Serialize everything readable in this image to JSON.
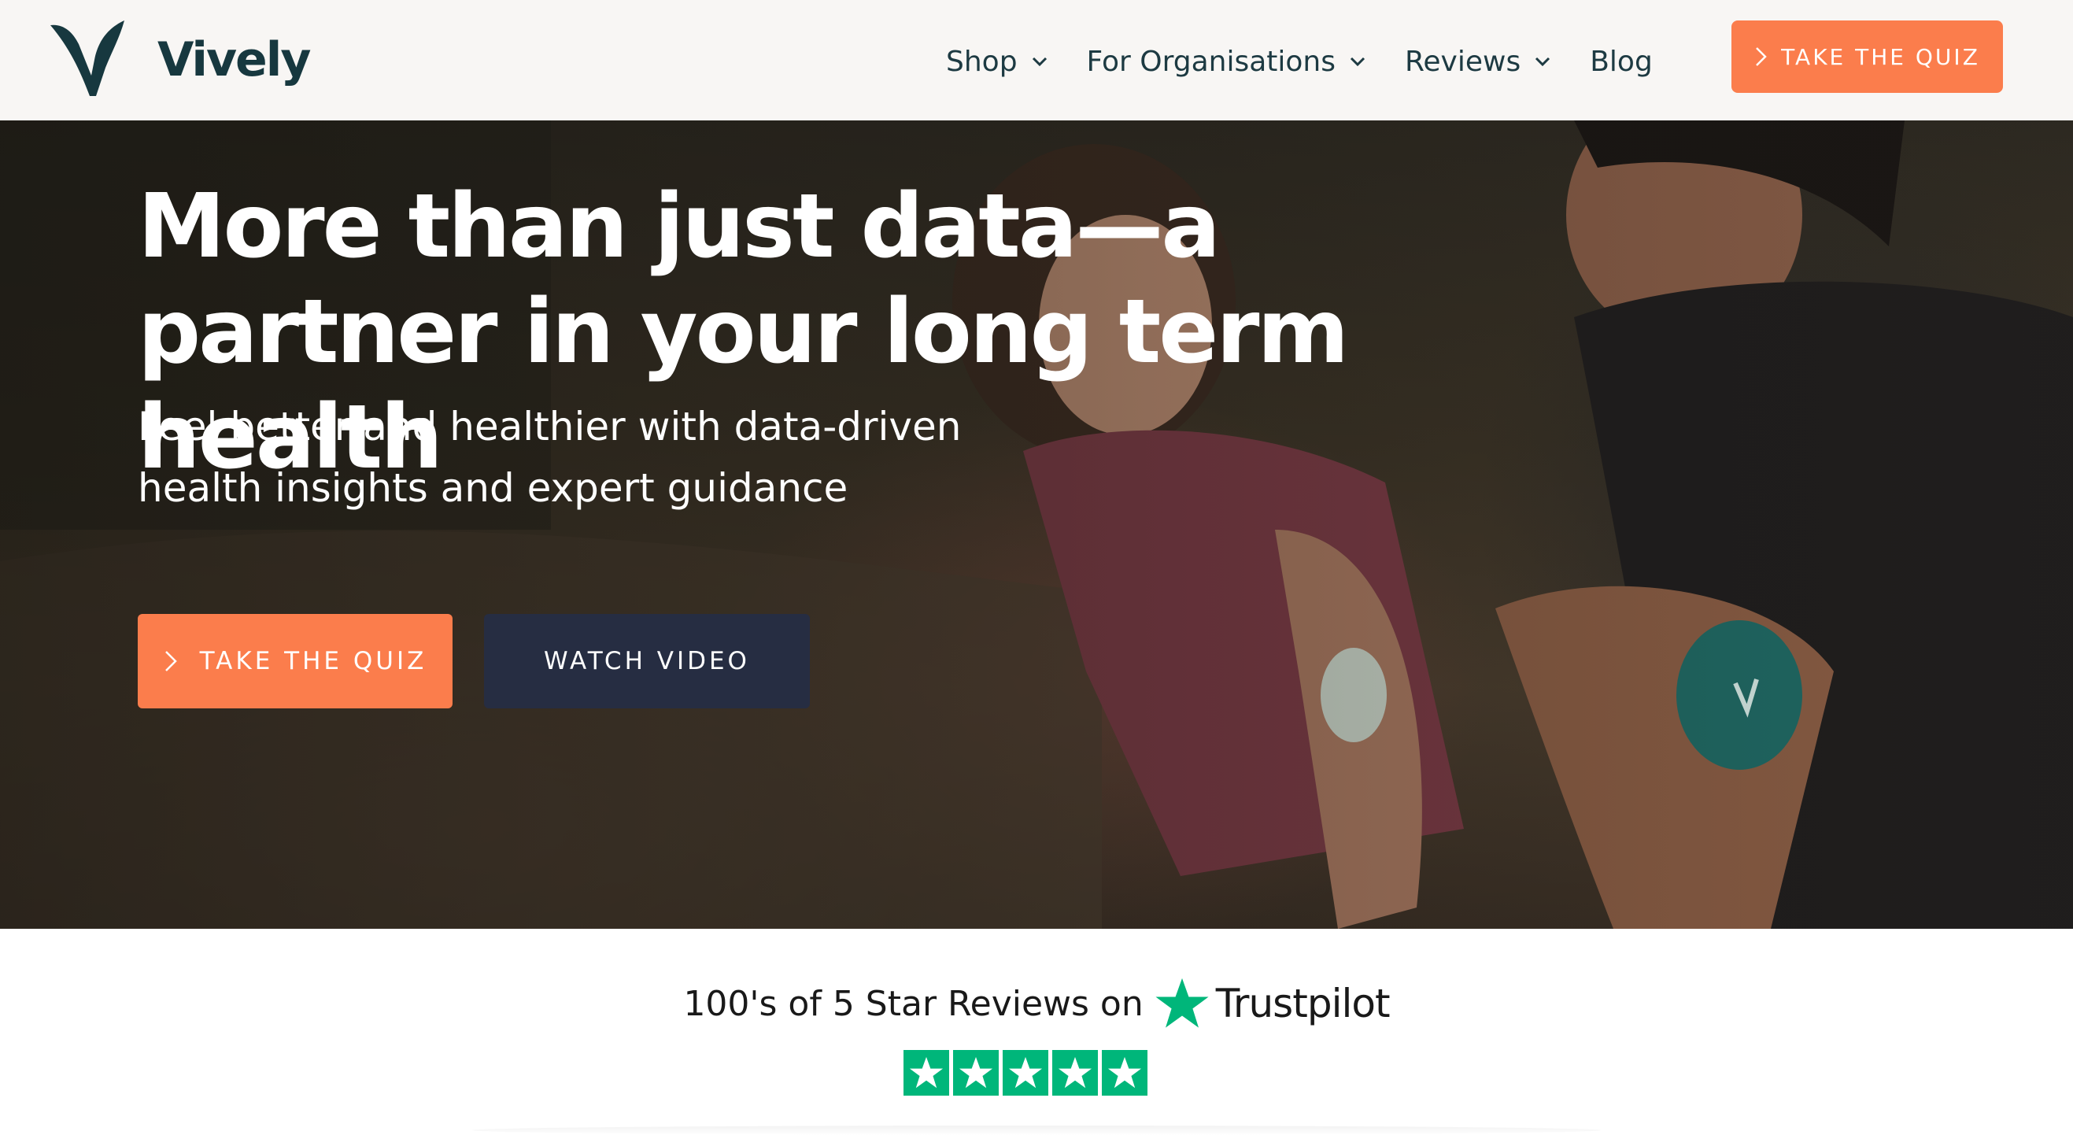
{
  "brand": {
    "name": "Vively",
    "logo_color": "#17383f"
  },
  "nav": {
    "items": [
      {
        "label": "Shop",
        "has_dropdown": true
      },
      {
        "label": "For Organisations",
        "has_dropdown": true
      },
      {
        "label": "Reviews",
        "has_dropdown": true
      },
      {
        "label": "Blog",
        "has_dropdown": false
      }
    ],
    "cta_label": "TAKE THE QUIZ"
  },
  "hero": {
    "title": "More than just data—a partner in your long term health",
    "subtitle": "Feel better and healthier with data-driven health insights and expert guidance",
    "primary_button": "TAKE THE QUIZ",
    "secondary_button": "WATCH VIDEO"
  },
  "trust": {
    "text": "100's of 5 Star Reviews on",
    "brand": "Trustpilot",
    "stars": 5,
    "star_color": "#00b67a"
  },
  "colors": {
    "accent": "#fb7d4c",
    "dark_button": "#262d42",
    "header_bg": "#f8f6f4"
  }
}
